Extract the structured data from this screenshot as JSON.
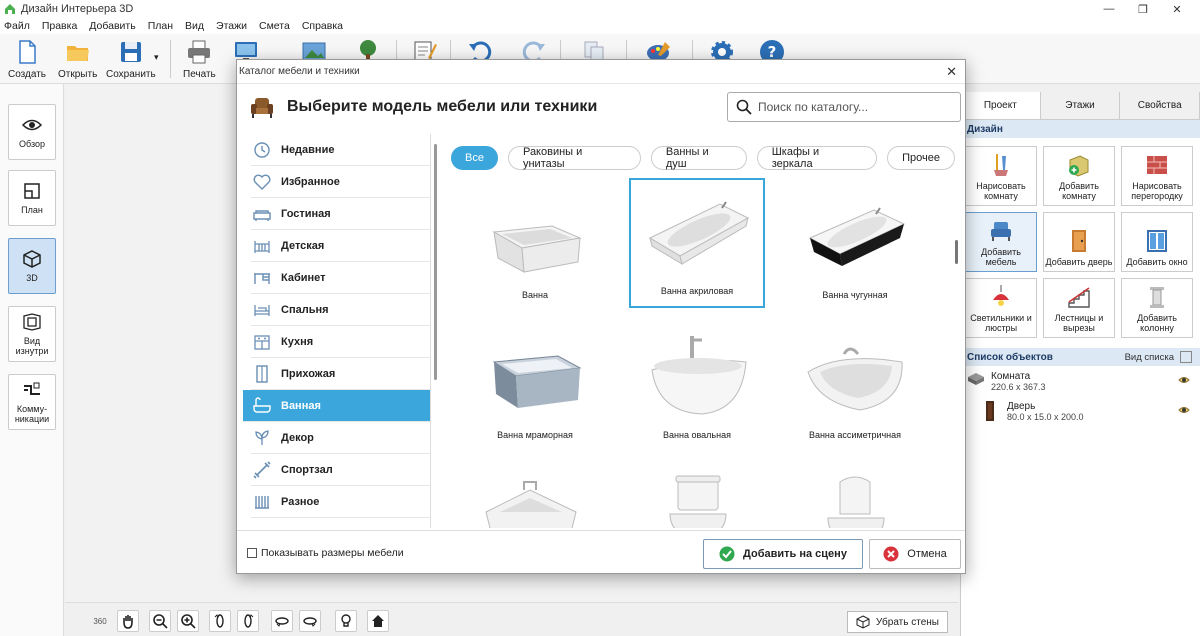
{
  "window": {
    "title": "Дизайн Интерьера 3D",
    "minimize": "—",
    "maximize": "❐",
    "close": "✕"
  },
  "menu": [
    "Файл",
    "Правка",
    "Добавить",
    "План",
    "Вид",
    "Этажи",
    "Смета",
    "Справка"
  ],
  "toolbar": {
    "create": "Создать",
    "open": "Открыть",
    "save": "Сохранить",
    "save_arrow": "▾",
    "print": "Печать",
    "preview": "П"
  },
  "leftbar": [
    {
      "label": "Обзор",
      "icon": "eye-icon"
    },
    {
      "label": "План",
      "icon": "plan-icon"
    },
    {
      "label": "3D",
      "icon": "cube-icon"
    },
    {
      "label": "Вид изнутри",
      "icon": "room-view-icon"
    },
    {
      "label": "Комму-никации",
      "icon": "pipes-icon"
    }
  ],
  "bottombar": {
    "remove_walls": "Убрать стены",
    "rotate360": "360"
  },
  "rightpanel": {
    "tabs": [
      "Проект",
      "Этажи",
      "Свойства"
    ],
    "design_header": "Дизайн",
    "design_buttons": [
      "Нарисовать комнату",
      "Добавить комнату",
      "Нарисовать перегородку",
      "Добавить мебель",
      "Добавить дверь",
      "Добавить окно",
      "Светильники и люстры",
      "Лестницы и вырезы",
      "Добавить колонну"
    ],
    "objects_header": "Список объектов",
    "view_list": "Вид списка",
    "objects": [
      {
        "name": "Комната",
        "dims": "220.6 x 367.3"
      },
      {
        "name": "Дверь",
        "dims": "80.0 x 15.0 x 200.0"
      }
    ]
  },
  "dialog": {
    "title": "Каталог мебели и техники",
    "close": "✕",
    "heading": "Выберите модель мебели или техники",
    "search_placeholder": "Поиск по каталогу...",
    "categories": [
      "Недавние",
      "Избранное",
      "Гостиная",
      "Детская",
      "Кабинет",
      "Спальня",
      "Кухня",
      "Прихожая",
      "Ванная",
      "Декор",
      "Спортзал",
      "Разное"
    ],
    "active_category": "Ванная",
    "filters": [
      "Все",
      "Раковины и унитазы",
      "Ванны и душ",
      "Шкафы и зеркала",
      "Прочее"
    ],
    "items": [
      "Ванна",
      "Ванна акриловая",
      "Ванна чугунная",
      "Ванна мраморная",
      "Ванна овальная",
      "Ванна ассиметричная",
      "",
      "",
      ""
    ],
    "selected_item": "Ванна акриловая",
    "show_sizes": "Показывать размеры мебели",
    "add_button": "Добавить на сцену",
    "cancel_button": "Отмена"
  },
  "colors": {
    "accent": "#3aa6dc",
    "panel_header": "#dce8f4",
    "add_green": "#2fa84f",
    "cancel_red": "#d9323a"
  }
}
